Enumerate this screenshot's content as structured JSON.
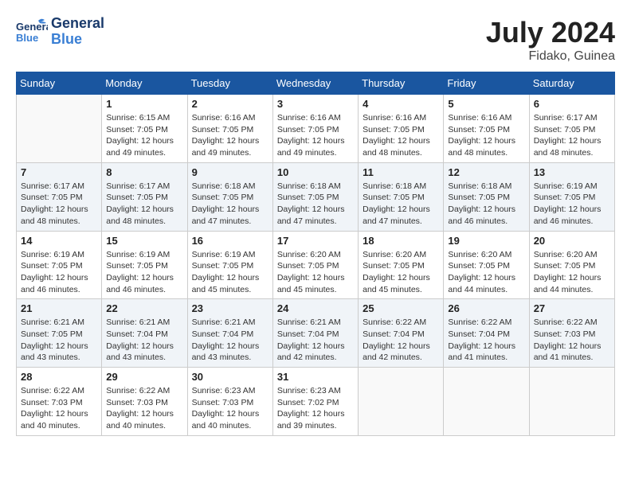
{
  "header": {
    "logo_general": "General",
    "logo_blue": "Blue",
    "month_title": "July 2024",
    "location": "Fidako, Guinea"
  },
  "days_of_week": [
    "Sunday",
    "Monday",
    "Tuesday",
    "Wednesday",
    "Thursday",
    "Friday",
    "Saturday"
  ],
  "weeks": [
    {
      "id": "week-1",
      "days": [
        {
          "num": "",
          "info": ""
        },
        {
          "num": "1",
          "info": "Sunrise: 6:15 AM\nSunset: 7:05 PM\nDaylight: 12 hours\nand 49 minutes."
        },
        {
          "num": "2",
          "info": "Sunrise: 6:16 AM\nSunset: 7:05 PM\nDaylight: 12 hours\nand 49 minutes."
        },
        {
          "num": "3",
          "info": "Sunrise: 6:16 AM\nSunset: 7:05 PM\nDaylight: 12 hours\nand 49 minutes."
        },
        {
          "num": "4",
          "info": "Sunrise: 6:16 AM\nSunset: 7:05 PM\nDaylight: 12 hours\nand 48 minutes."
        },
        {
          "num": "5",
          "info": "Sunrise: 6:16 AM\nSunset: 7:05 PM\nDaylight: 12 hours\nand 48 minutes."
        },
        {
          "num": "6",
          "info": "Sunrise: 6:17 AM\nSunset: 7:05 PM\nDaylight: 12 hours\nand 48 minutes."
        }
      ]
    },
    {
      "id": "week-2",
      "days": [
        {
          "num": "7",
          "info": "Sunrise: 6:17 AM\nSunset: 7:05 PM\nDaylight: 12 hours\nand 48 minutes."
        },
        {
          "num": "8",
          "info": "Sunrise: 6:17 AM\nSunset: 7:05 PM\nDaylight: 12 hours\nand 48 minutes."
        },
        {
          "num": "9",
          "info": "Sunrise: 6:18 AM\nSunset: 7:05 PM\nDaylight: 12 hours\nand 47 minutes."
        },
        {
          "num": "10",
          "info": "Sunrise: 6:18 AM\nSunset: 7:05 PM\nDaylight: 12 hours\nand 47 minutes."
        },
        {
          "num": "11",
          "info": "Sunrise: 6:18 AM\nSunset: 7:05 PM\nDaylight: 12 hours\nand 47 minutes."
        },
        {
          "num": "12",
          "info": "Sunrise: 6:18 AM\nSunset: 7:05 PM\nDaylight: 12 hours\nand 46 minutes."
        },
        {
          "num": "13",
          "info": "Sunrise: 6:19 AM\nSunset: 7:05 PM\nDaylight: 12 hours\nand 46 minutes."
        }
      ]
    },
    {
      "id": "week-3",
      "days": [
        {
          "num": "14",
          "info": "Sunrise: 6:19 AM\nSunset: 7:05 PM\nDaylight: 12 hours\nand 46 minutes."
        },
        {
          "num": "15",
          "info": "Sunrise: 6:19 AM\nSunset: 7:05 PM\nDaylight: 12 hours\nand 46 minutes."
        },
        {
          "num": "16",
          "info": "Sunrise: 6:19 AM\nSunset: 7:05 PM\nDaylight: 12 hours\nand 45 minutes."
        },
        {
          "num": "17",
          "info": "Sunrise: 6:20 AM\nSunset: 7:05 PM\nDaylight: 12 hours\nand 45 minutes."
        },
        {
          "num": "18",
          "info": "Sunrise: 6:20 AM\nSunset: 7:05 PM\nDaylight: 12 hours\nand 45 minutes."
        },
        {
          "num": "19",
          "info": "Sunrise: 6:20 AM\nSunset: 7:05 PM\nDaylight: 12 hours\nand 44 minutes."
        },
        {
          "num": "20",
          "info": "Sunrise: 6:20 AM\nSunset: 7:05 PM\nDaylight: 12 hours\nand 44 minutes."
        }
      ]
    },
    {
      "id": "week-4",
      "days": [
        {
          "num": "21",
          "info": "Sunrise: 6:21 AM\nSunset: 7:05 PM\nDaylight: 12 hours\nand 43 minutes."
        },
        {
          "num": "22",
          "info": "Sunrise: 6:21 AM\nSunset: 7:04 PM\nDaylight: 12 hours\nand 43 minutes."
        },
        {
          "num": "23",
          "info": "Sunrise: 6:21 AM\nSunset: 7:04 PM\nDaylight: 12 hours\nand 43 minutes."
        },
        {
          "num": "24",
          "info": "Sunrise: 6:21 AM\nSunset: 7:04 PM\nDaylight: 12 hours\nand 42 minutes."
        },
        {
          "num": "25",
          "info": "Sunrise: 6:22 AM\nSunset: 7:04 PM\nDaylight: 12 hours\nand 42 minutes."
        },
        {
          "num": "26",
          "info": "Sunrise: 6:22 AM\nSunset: 7:04 PM\nDaylight: 12 hours\nand 41 minutes."
        },
        {
          "num": "27",
          "info": "Sunrise: 6:22 AM\nSunset: 7:03 PM\nDaylight: 12 hours\nand 41 minutes."
        }
      ]
    },
    {
      "id": "week-5",
      "days": [
        {
          "num": "28",
          "info": "Sunrise: 6:22 AM\nSunset: 7:03 PM\nDaylight: 12 hours\nand 40 minutes."
        },
        {
          "num": "29",
          "info": "Sunrise: 6:22 AM\nSunset: 7:03 PM\nDaylight: 12 hours\nand 40 minutes."
        },
        {
          "num": "30",
          "info": "Sunrise: 6:23 AM\nSunset: 7:03 PM\nDaylight: 12 hours\nand 40 minutes."
        },
        {
          "num": "31",
          "info": "Sunrise: 6:23 AM\nSunset: 7:02 PM\nDaylight: 12 hours\nand 39 minutes."
        },
        {
          "num": "",
          "info": ""
        },
        {
          "num": "",
          "info": ""
        },
        {
          "num": "",
          "info": ""
        }
      ]
    }
  ]
}
